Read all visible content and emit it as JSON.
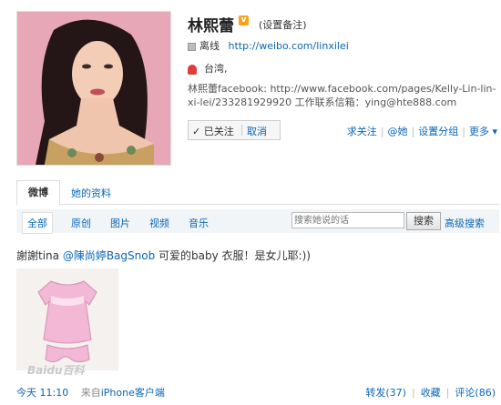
{
  "profile": {
    "name": "林熙蕾",
    "v_badge": "v",
    "remark_link": "(设置备注)",
    "status": "离线",
    "url": "http://weibo.com/linxilei",
    "location": "台湾,",
    "bio": "林熙蕾facebook: http://www.facebook.com/pages/Kelly-Lin-lin-xi-lei/233281929920 工作联系信箱：ying@hte888.com",
    "followed_label": "✓ 已关注",
    "cancel_label": "取消",
    "actions": [
      "求关注",
      "@她",
      "设置分组",
      "更多 ▾"
    ]
  },
  "tabs": [
    "微博",
    "她的资料"
  ],
  "filters": [
    "全部",
    "原创",
    "图片",
    "视频",
    "音乐"
  ],
  "search": {
    "placeholder": "搜索她说的话",
    "button": "搜索",
    "advanced": "高级搜索"
  },
  "post": {
    "text_prefix": "謝謝tina ",
    "mention": "@陳尚婷BagSnob",
    "text_suffix": " 可爱的baby 衣服！是女儿耶:))",
    "watermark": "Baidu百科",
    "time": "今天 11:10",
    "source_prefix": "来自",
    "source": "iPhone客户端",
    "repost": "转发(37)",
    "favorite": "收藏",
    "comment": "评论(86)"
  },
  "colors": {
    "link": "#0a66b8",
    "badge": "#f7a21b",
    "dress": "#f2b8d6"
  }
}
